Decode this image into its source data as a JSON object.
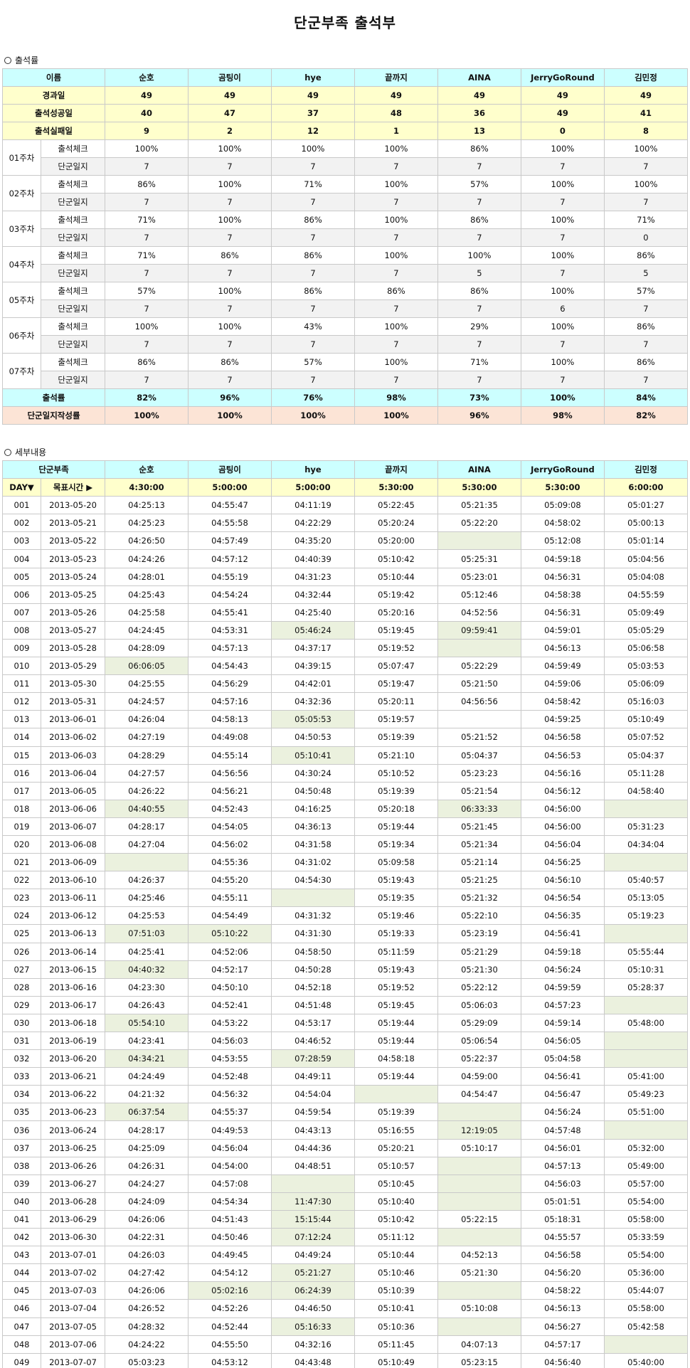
{
  "title": "단군부족 출석부",
  "s1": "출석률",
  "s2": "세부내용",
  "members": [
    "순호",
    "곰팅이",
    "hye",
    "끝까지",
    "AINA",
    "JerryGoRound",
    "김민정"
  ],
  "t1": {
    "head": "이름",
    "rows": [
      {
        "label": "경과일",
        "vals": [
          "49",
          "49",
          "49",
          "49",
          "49",
          "49",
          "49"
        ]
      },
      {
        "label": "출석성공일",
        "vals": [
          "40",
          "47",
          "37",
          "48",
          "36",
          "49",
          "41"
        ]
      },
      {
        "label": "출석실패일",
        "vals": [
          "9",
          "2",
          "12",
          "1",
          "13",
          "0",
          "8"
        ]
      }
    ],
    "check": "출석체크",
    "diary": "단군일지",
    "weeks": [
      {
        "w": "01주차",
        "c": [
          "100%",
          "100%",
          "100%",
          "100%",
          "86%",
          "100%",
          "100%"
        ],
        "d": [
          "7",
          "7",
          "7",
          "7",
          "7",
          "7",
          "7"
        ]
      },
      {
        "w": "02주차",
        "c": [
          "86%",
          "100%",
          "71%",
          "100%",
          "57%",
          "100%",
          "100%"
        ],
        "d": [
          "7",
          "7",
          "7",
          "7",
          "7",
          "7",
          "7"
        ]
      },
      {
        "w": "03주차",
        "c": [
          "71%",
          "100%",
          "86%",
          "100%",
          "86%",
          "100%",
          "71%"
        ],
        "d": [
          "7",
          "7",
          "7",
          "7",
          "7",
          "7",
          "0"
        ]
      },
      {
        "w": "04주차",
        "c": [
          "71%",
          "86%",
          "86%",
          "100%",
          "100%",
          "100%",
          "86%"
        ],
        "d": [
          "7",
          "7",
          "7",
          "7",
          "5",
          "7",
          "5"
        ]
      },
      {
        "w": "05주차",
        "c": [
          "57%",
          "100%",
          "86%",
          "86%",
          "86%",
          "100%",
          "57%"
        ],
        "d": [
          "7",
          "7",
          "7",
          "7",
          "7",
          "6",
          "7"
        ]
      },
      {
        "w": "06주차",
        "c": [
          "100%",
          "100%",
          "43%",
          "100%",
          "29%",
          "100%",
          "86%"
        ],
        "d": [
          "7",
          "7",
          "7",
          "7",
          "7",
          "7",
          "7"
        ]
      },
      {
        "w": "07주차",
        "c": [
          "86%",
          "86%",
          "57%",
          "100%",
          "71%",
          "100%",
          "86%"
        ],
        "d": [
          "7",
          "7",
          "7",
          "7",
          "7",
          "7",
          "7"
        ]
      }
    ],
    "rate": {
      "label": "출석률",
      "vals": [
        "82%",
        "96%",
        "76%",
        "98%",
        "73%",
        "100%",
        "84%"
      ]
    },
    "jrate": {
      "label": "단군일지작성률",
      "vals": [
        "100%",
        "100%",
        "100%",
        "100%",
        "96%",
        "98%",
        "82%"
      ]
    }
  },
  "t2": {
    "head": "단군부족",
    "day": "DAY▼",
    "goal": "목표시간 ▶",
    "goals": [
      "4:30:00",
      "5:00:00",
      "5:00:00",
      "5:30:00",
      "5:30:00",
      "5:30:00",
      "6:00:00"
    ],
    "rows": [
      [
        "001",
        "2013-05-20",
        "04:25:13",
        "04:55:47",
        "04:11:19",
        "05:22:45",
        "05:21:35",
        "05:09:08",
        "05:01:27"
      ],
      [
        "002",
        "2013-05-21",
        "04:25:23",
        "04:55:58",
        "04:22:29",
        "05:20:24",
        "05:22:20",
        "04:58:02",
        "05:00:13"
      ],
      [
        "003",
        "2013-05-22",
        "04:26:50",
        "04:57:49",
        "04:35:20",
        "05:20:00",
        "",
        "05:12:08",
        "05:01:14"
      ],
      [
        "004",
        "2013-05-23",
        "04:24:26",
        "04:57:12",
        "04:40:39",
        "05:10:42",
        "05:25:31",
        "04:59:18",
        "05:04:56"
      ],
      [
        "005",
        "2013-05-24",
        "04:28:01",
        "04:55:19",
        "04:31:23",
        "05:10:44",
        "05:23:01",
        "04:56:31",
        "05:04:08"
      ],
      [
        "006",
        "2013-05-25",
        "04:25:43",
        "04:54:24",
        "04:32:44",
        "05:19:42",
        "05:12:46",
        "04:58:38",
        "04:55:59"
      ],
      [
        "007",
        "2013-05-26",
        "04:25:58",
        "04:55:41",
        "04:25:40",
        "05:20:16",
        "04:52:56",
        "04:56:31",
        "05:09:49"
      ],
      [
        "008",
        "2013-05-27",
        "04:24:45",
        "04:53:31",
        "05:46:24",
        "05:19:45",
        "09:59:41",
        "04:59:01",
        "05:05:29"
      ],
      [
        "009",
        "2013-05-28",
        "04:28:09",
        "04:57:13",
        "04:37:17",
        "05:19:52",
        "",
        "04:56:13",
        "05:06:58"
      ],
      [
        "010",
        "2013-05-29",
        "06:06:05",
        "04:54:43",
        "04:39:15",
        "05:07:47",
        "05:22:29",
        "04:59:49",
        "05:03:53"
      ],
      [
        "011",
        "2013-05-30",
        "04:25:55",
        "04:56:29",
        "04:42:01",
        "05:19:47",
        "05:21:50",
        "04:59:06",
        "05:06:09"
      ],
      [
        "012",
        "2013-05-31",
        "04:24:57",
        "04:57:16",
        "04:32:36",
        "05:20:11",
        "04:56:56",
        "04:58:42",
        "05:16:03"
      ],
      [
        "013",
        "2013-06-01",
        "04:26:04",
        "04:58:13",
        "05:05:53",
        "05:19:57",
        "",
        "04:59:25",
        "05:10:49"
      ],
      [
        "014",
        "2013-06-02",
        "04:27:19",
        "04:49:08",
        "04:50:53",
        "05:19:39",
        "05:21:52",
        "04:56:58",
        "05:07:52"
      ],
      [
        "015",
        "2013-06-03",
        "04:28:29",
        "04:55:14",
        "05:10:41",
        "05:21:10",
        "05:04:37",
        "04:56:53",
        "05:04:37"
      ],
      [
        "016",
        "2013-06-04",
        "04:27:57",
        "04:56:56",
        "04:30:24",
        "05:10:52",
        "05:23:23",
        "04:56:16",
        "05:11:28"
      ],
      [
        "017",
        "2013-06-05",
        "04:26:22",
        "04:56:21",
        "04:50:48",
        "05:19:39",
        "05:21:54",
        "04:56:12",
        "04:58:40"
      ],
      [
        "018",
        "2013-06-06",
        "04:40:55",
        "04:52:43",
        "04:16:25",
        "05:20:18",
        "06:33:33",
        "04:56:00",
        ""
      ],
      [
        "019",
        "2013-06-07",
        "04:28:17",
        "04:54:05",
        "04:36:13",
        "05:19:44",
        "05:21:45",
        "04:56:00",
        "05:31:23"
      ],
      [
        "020",
        "2013-06-08",
        "04:27:04",
        "04:56:02",
        "04:31:58",
        "05:19:34",
        "05:21:34",
        "04:56:04",
        "04:34:04"
      ],
      [
        "021",
        "2013-06-09",
        "",
        "04:55:36",
        "04:31:02",
        "05:09:58",
        "05:21:14",
        "04:56:25",
        ""
      ],
      [
        "022",
        "2013-06-10",
        "04:26:37",
        "04:55:20",
        "04:54:30",
        "05:19:43",
        "05:21:25",
        "04:56:10",
        "05:40:57"
      ],
      [
        "023",
        "2013-06-11",
        "04:25:46",
        "04:55:11",
        "",
        "05:19:35",
        "05:21:32",
        "04:56:54",
        "05:13:05"
      ],
      [
        "024",
        "2013-06-12",
        "04:25:53",
        "04:54:49",
        "04:31:32",
        "05:19:46",
        "05:22:10",
        "04:56:35",
        "05:19:23"
      ],
      [
        "025",
        "2013-06-13",
        "07:51:03",
        "05:10:22",
        "04:31:30",
        "05:19:33",
        "05:23:19",
        "04:56:41",
        ""
      ],
      [
        "026",
        "2013-06-14",
        "04:25:41",
        "04:52:06",
        "04:58:50",
        "05:11:59",
        "05:21:29",
        "04:59:18",
        "05:55:44"
      ],
      [
        "027",
        "2013-06-15",
        "04:40:32",
        "04:52:17",
        "04:50:28",
        "05:19:43",
        "05:21:30",
        "04:56:24",
        "05:10:31"
      ],
      [
        "028",
        "2013-06-16",
        "04:23:30",
        "04:50:10",
        "04:52:18",
        "05:19:52",
        "05:22:12",
        "04:59:59",
        "05:28:37"
      ],
      [
        "029",
        "2013-06-17",
        "04:26:43",
        "04:52:41",
        "04:51:48",
        "05:19:45",
        "05:06:03",
        "04:57:23",
        ""
      ],
      [
        "030",
        "2013-06-18",
        "05:54:10",
        "04:53:22",
        "04:53:17",
        "05:19:44",
        "05:29:09",
        "04:59:14",
        "05:48:00"
      ],
      [
        "031",
        "2013-06-19",
        "04:23:41",
        "04:56:03",
        "04:46:52",
        "05:19:44",
        "05:06:54",
        "04:56:05",
        ""
      ],
      [
        "032",
        "2013-06-20",
        "04:34:21",
        "04:53:55",
        "07:28:59",
        "04:58:18",
        "05:22:37",
        "05:04:58",
        ""
      ],
      [
        "033",
        "2013-06-21",
        "04:24:49",
        "04:52:48",
        "04:49:11",
        "05:19:44",
        "04:59:00",
        "04:56:41",
        "05:41:00"
      ],
      [
        "034",
        "2013-06-22",
        "04:21:32",
        "04:56:32",
        "04:54:04",
        "",
        "04:54:47",
        "04:56:47",
        "05:49:23"
      ],
      [
        "035",
        "2013-06-23",
        "06:37:54",
        "04:55:37",
        "04:59:54",
        "05:19:39",
        "",
        "04:56:24",
        "05:51:00"
      ],
      [
        "036",
        "2013-06-24",
        "04:28:17",
        "04:49:53",
        "04:43:13",
        "05:16:55",
        "12:19:05",
        "04:57:48",
        ""
      ],
      [
        "037",
        "2013-06-25",
        "04:25:09",
        "04:56:04",
        "04:44:36",
        "05:20:21",
        "05:10:17",
        "04:56:01",
        "05:32:00"
      ],
      [
        "038",
        "2013-06-26",
        "04:26:31",
        "04:54:00",
        "04:48:51",
        "05:10:57",
        "",
        "04:57:13",
        "05:49:00"
      ],
      [
        "039",
        "2013-06-27",
        "04:24:27",
        "04:57:08",
        "",
        "05:10:45",
        "",
        "04:56:03",
        "05:57:00"
      ],
      [
        "040",
        "2013-06-28",
        "04:24:09",
        "04:54:34",
        "11:47:30",
        "05:10:40",
        "",
        "05:01:51",
        "05:54:00"
      ],
      [
        "041",
        "2013-06-29",
        "04:26:06",
        "04:51:43",
        "15:15:44",
        "05:10:42",
        "05:22:15",
        "05:18:31",
        "05:58:00"
      ],
      [
        "042",
        "2013-06-30",
        "04:22:31",
        "04:50:46",
        "07:12:24",
        "05:11:12",
        "",
        "04:55:57",
        "05:33:59"
      ],
      [
        "043",
        "2013-07-01",
        "04:26:03",
        "04:49:45",
        "04:49:24",
        "05:10:44",
        "04:52:13",
        "04:56:58",
        "05:54:00"
      ],
      [
        "044",
        "2013-07-02",
        "04:27:42",
        "04:54:12",
        "05:21:27",
        "05:10:46",
        "05:21:30",
        "04:56:20",
        "05:36:00"
      ],
      [
        "045",
        "2013-07-03",
        "04:26:06",
        "05:02:16",
        "06:24:39",
        "05:10:39",
        "",
        "04:58:22",
        "05:44:07"
      ],
      [
        "046",
        "2013-07-04",
        "04:26:52",
        "04:52:26",
        "04:46:50",
        "05:10:41",
        "05:10:08",
        "04:56:13",
        "05:58:00"
      ],
      [
        "047",
        "2013-07-05",
        "04:28:32",
        "04:52:44",
        "05:16:33",
        "05:10:36",
        "",
        "04:56:27",
        "05:42:58"
      ],
      [
        "048",
        "2013-07-06",
        "04:24:22",
        "04:55:50",
        "04:32:16",
        "05:11:45",
        "04:07:13",
        "04:57:17",
        ""
      ],
      [
        "049",
        "2013-07-07",
        "05:03:23",
        "04:53:12",
        "04:43:48",
        "05:10:49",
        "05:23:15",
        "04:56:40",
        "05:40:00"
      ]
    ],
    "highlight": [
      "008:4",
      "008:6",
      "010:2",
      "013:4",
      "015:4",
      "018:2",
      "018:6",
      "018:8",
      "021:2",
      "021:8",
      "023:4",
      "025:2",
      "025:3",
      "025:8",
      "027:2",
      "029:8",
      "030:2",
      "031:8",
      "032:2",
      "032:4",
      "032:8",
      "034:5",
      "035:2",
      "035:6",
      "036:6",
      "036:8",
      "038:6",
      "039:4",
      "039:6",
      "040:4",
      "040:6",
      "041:4",
      "042:4",
      "042:6",
      "044:4",
      "045:3",
      "045:4",
      "045:6",
      "047:4",
      "047:6",
      "048:8",
      "003:6",
      "009:6"
    ]
  }
}
